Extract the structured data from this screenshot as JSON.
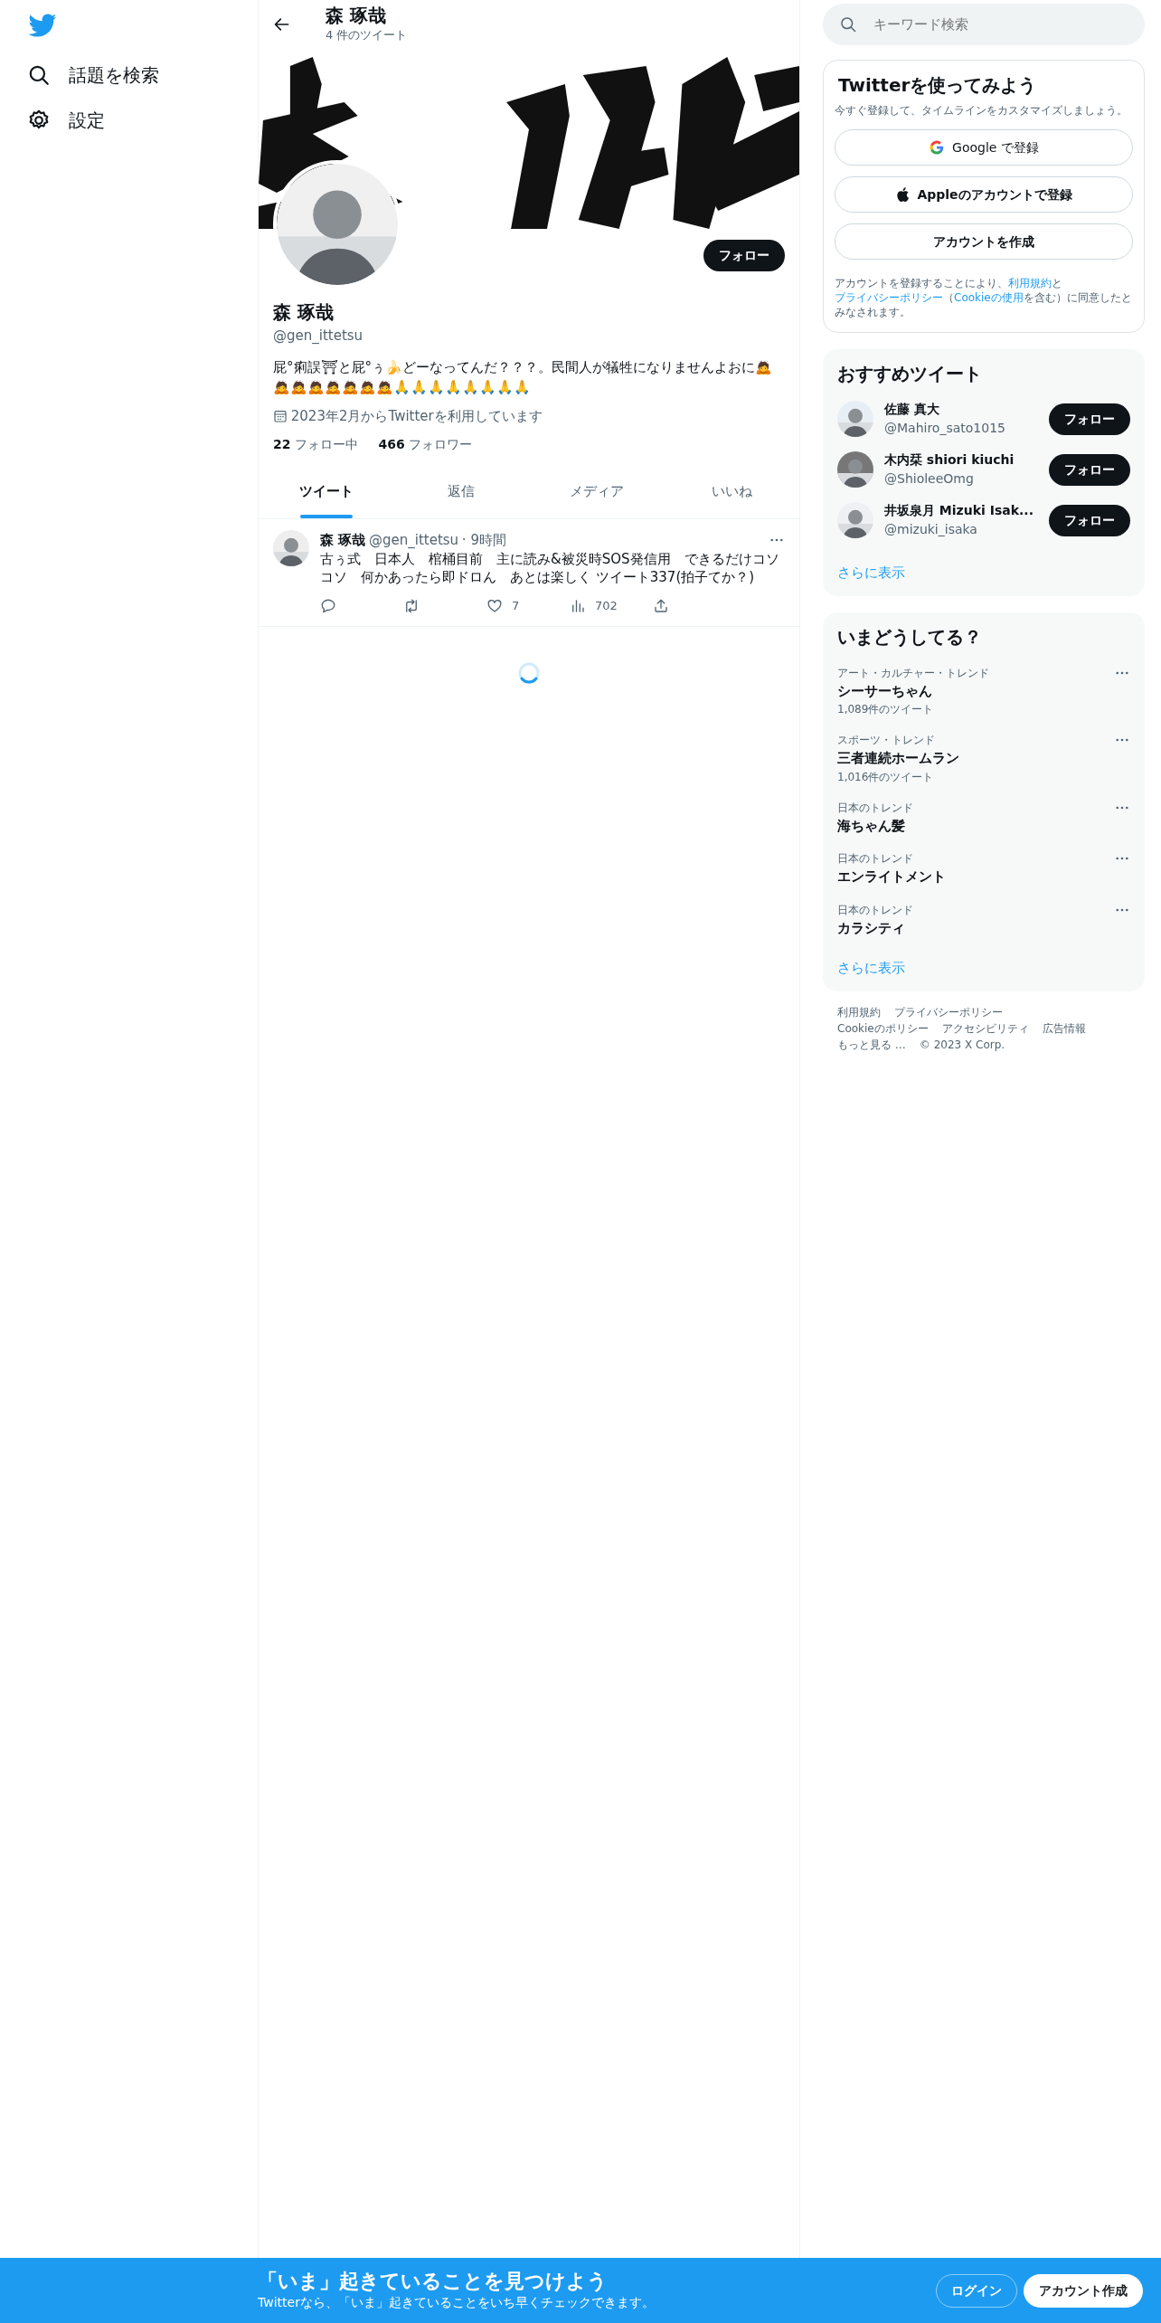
{
  "sidebar": {
    "items": [
      {
        "label": "話題を検索",
        "kind": "search"
      },
      {
        "label": "設定",
        "kind": "settings"
      }
    ]
  },
  "header": {
    "title": "森 琢哉",
    "subtitle": "4 件のツイート"
  },
  "profile": {
    "follow_button": "フォロー",
    "name": "森 琢哉",
    "handle": "@gen_ittetsu",
    "bio": "屁°痢誤⛩と屁°ぅ🍌どーなってんだ？？？。民間人が犠牲になりませんよおに🙇🙇🙇🙇🙇🙇🙇🙇🙏🙏🙏🙏🙏🙏🙏🙏",
    "joined": "2023年2月からTwitterを利用しています",
    "following_count": "22",
    "following_label": "フォロー中",
    "followers_count": "466",
    "followers_label": "フォロワー"
  },
  "tabs": [
    {
      "label": "ツイート",
      "selected": true
    },
    {
      "label": "返信",
      "selected": false
    },
    {
      "label": "メディア",
      "selected": false
    },
    {
      "label": "いいね",
      "selected": false
    }
  ],
  "tweets": [
    {
      "name": "森 琢哉",
      "handle": "@gen_ittetsu",
      "time": "· 9時間",
      "text": "古ぅ式　日本人　棺桶目前　主に読み&被災時SOS発信用　できるだけコソコソ　何かあったら即ドロん　あとは楽しく ツイート337(拍子てか？)",
      "likes": "7",
      "views": "702"
    }
  ],
  "search": {
    "placeholder": "キーワード検索"
  },
  "signup": {
    "title": "Twitterを使ってみよう",
    "subtitle": "今すぐ登録して、タイムラインをカスタマイズしましょう。",
    "buttons": [
      {
        "label": "Google で登録",
        "kind": "google"
      },
      {
        "label": "Appleのアカウントで登録",
        "kind": "apple"
      },
      {
        "label": "アカウントを作成",
        "kind": "plain"
      }
    ],
    "legal": [
      {
        "text": "アカウントを登録することにより、",
        "link": false
      },
      {
        "text": "利用規約",
        "link": true
      },
      {
        "text": "と",
        "link": false
      },
      {
        "text": "プライバシーポリシー",
        "link": true
      },
      {
        "text": "（",
        "link": false
      },
      {
        "text": "Cookieの使用",
        "link": true
      },
      {
        "text": "を含む）に同意したとみなされます。",
        "link": false
      }
    ]
  },
  "who_to_follow": {
    "title": "おすすめツイート",
    "users": [
      {
        "name": "佐藤 真大",
        "handle": "@Mahiro_sato1015",
        "button": "フォロー"
      },
      {
        "name": "木内栞 shiori kiuchi",
        "handle": "@ShioleeOmg",
        "button": "フォロー"
      },
      {
        "name": "井坂泉月 Mizuki Isak...",
        "handle": "@mizuki_isaka",
        "button": "フォロー"
      }
    ],
    "more": "さらに表示"
  },
  "trends": {
    "title": "いまどうしてる？",
    "items": [
      {
        "context": "アート・カルチャー・トレンド",
        "name": "シーサーちゃん",
        "count": "1,089件のツイート"
      },
      {
        "context": "スポーツ・トレンド",
        "name": "三者連続ホームラン",
        "count": "1,016件のツイート"
      },
      {
        "context": "日本のトレンド",
        "name": "海ちゃん髪"
      },
      {
        "context": "日本のトレンド",
        "name": "エンライトメント"
      },
      {
        "context": "日本のトレンド",
        "name": "カラシティ"
      }
    ],
    "more": "さらに表示"
  },
  "footer": {
    "lines": [
      [
        "利用規約",
        "プライバシーポリシー"
      ],
      [
        "Cookieのポリシー",
        "アクセシビリティ",
        "広告情報"
      ],
      [
        "もっと見る …"
      ]
    ],
    "copyright": "© 2023 X Corp."
  },
  "bottom_bar": {
    "title": "「いま」起きていることを見つけよう",
    "subtitle": "Twitterなら、「いま」起きていることをいち早くチェックできます。",
    "login": "ログイン",
    "signup": "アカウント作成"
  }
}
